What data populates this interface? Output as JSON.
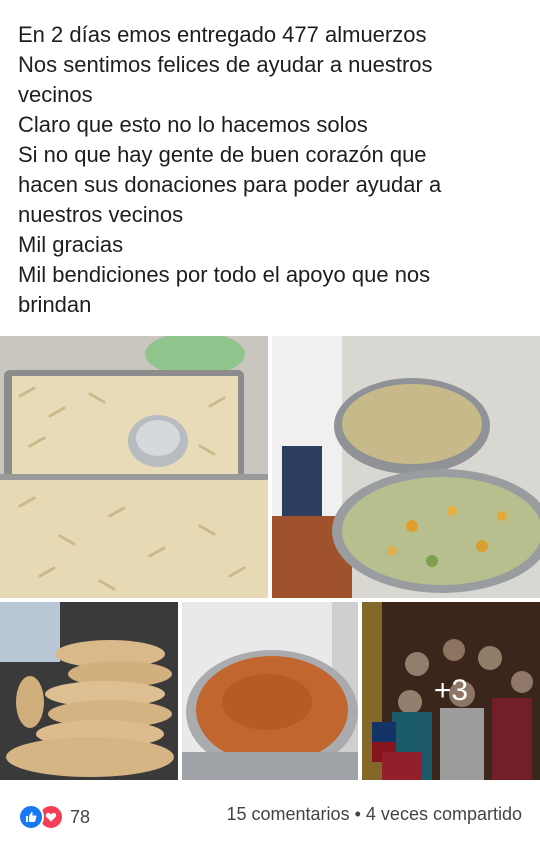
{
  "post": {
    "lines": [
      "En 2 días emos entregado 477 almuerzos",
      "Nos sentimos felices de ayudar a nuestros",
      "vecinos",
      "Claro que esto no lo hacemos solos",
      "Si no  que hay gente de buen corazón que",
      "hacen sus donaciones para poder ayudar a",
      "nuestros vecinos",
      "Mil gracias",
      "Mil bendiciones por todo el apoyo que nos",
      "brindan"
    ]
  },
  "photos": {
    "more_label": "+3"
  },
  "footer": {
    "reaction_icons": [
      "like-icon",
      "love-icon"
    ],
    "reaction_count": "78",
    "comments": "15 comentarios",
    "separator": "•",
    "shares": "4 veces compartido"
  },
  "colors": {
    "like": "#1877f2",
    "love": "#f33e58",
    "text": "#1c1e21"
  }
}
